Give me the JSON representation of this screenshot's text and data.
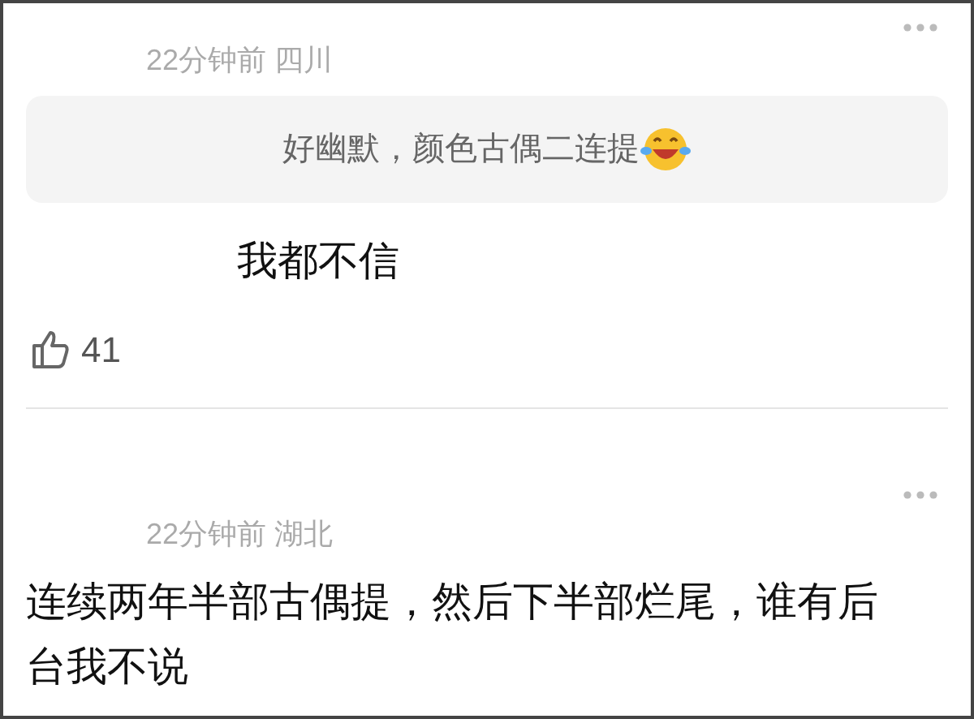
{
  "comments": [
    {
      "meta": "22分钟前 四川",
      "quote": "好幽默，颜色古偶二连提",
      "text": "我都不信",
      "likes": "41"
    },
    {
      "meta": "22分钟前 湖北",
      "text": "连续两年半部古偶提，然后下半部烂尾，谁有后台我不说"
    }
  ]
}
